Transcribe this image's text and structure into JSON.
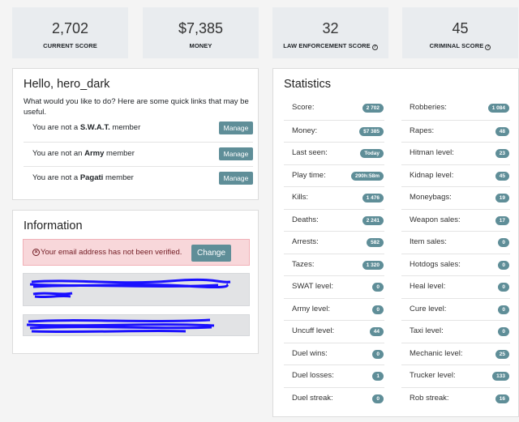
{
  "top_stats": [
    {
      "value": "2,702",
      "label": "CURRENT SCORE",
      "help": false
    },
    {
      "value": "$7,385",
      "label": "MONEY",
      "help": false
    },
    {
      "value": "32",
      "label": "LAW ENFORCEMENT SCORE",
      "help": true
    },
    {
      "value": "45",
      "label": "CRIMINAL SCORE",
      "help": true
    }
  ],
  "help_glyph": "?",
  "hello": {
    "title": "Hello, hero_dark",
    "intro": "What would you like to do? Here are some quick links that may be useful.",
    "rows": [
      {
        "pre": "You are not a ",
        "group": "S.W.A.T.",
        "post": " member",
        "button": "Manage"
      },
      {
        "pre": "You are not an ",
        "group": "Army",
        "post": " member",
        "button": "Manage"
      },
      {
        "pre": "You are not a ",
        "group": "Pagati",
        "post": " member",
        "button": "Manage"
      }
    ]
  },
  "information": {
    "title": "Information",
    "alert_icon": "x-circle-icon",
    "alert_glyph": "×",
    "alert_text": "Your email address has not been verified.",
    "change_button": "Change"
  },
  "statistics": {
    "title": "Statistics",
    "left": [
      {
        "label": "Score:",
        "value": "2 702"
      },
      {
        "label": "Money:",
        "value": "$7 385"
      },
      {
        "label": "Last seen:",
        "value": "Today"
      },
      {
        "label": "Play time:",
        "value": "290h:58m"
      },
      {
        "label": "Kills:",
        "value": "1 476"
      },
      {
        "label": "Deaths:",
        "value": "2 241"
      },
      {
        "label": "Arrests:",
        "value": "582"
      },
      {
        "label": "Tazes:",
        "value": "1 320"
      },
      {
        "label": "SWAT level:",
        "value": "0"
      },
      {
        "label": "Army level:",
        "value": "0"
      },
      {
        "label": "Uncuff level:",
        "value": "44"
      },
      {
        "label": "Duel wins:",
        "value": "0"
      },
      {
        "label": "Duel losses:",
        "value": "1"
      },
      {
        "label": "Duel streak:",
        "value": "0"
      }
    ],
    "right": [
      {
        "label": "Robberies:",
        "value": "1 084"
      },
      {
        "label": "Rapes:",
        "value": "48"
      },
      {
        "label": "Hitman level:",
        "value": "23"
      },
      {
        "label": "Kidnap level:",
        "value": "45"
      },
      {
        "label": "Moneybags:",
        "value": "19"
      },
      {
        "label": "Weapon sales:",
        "value": "17"
      },
      {
        "label": "Item sales:",
        "value": "0"
      },
      {
        "label": "Hotdogs sales:",
        "value": "0"
      },
      {
        "label": "Heal level:",
        "value": "0"
      },
      {
        "label": "Cure level:",
        "value": "0"
      },
      {
        "label": "Taxi level:",
        "value": "0"
      },
      {
        "label": "Mechanic level:",
        "value": "25"
      },
      {
        "label": "Trucker level:",
        "value": "133"
      },
      {
        "label": "Rob streak:",
        "value": "16"
      }
    ]
  },
  "colors": {
    "accent": "#5f8e98",
    "card_bg": "#e9ecef",
    "alert_bg": "#f8d7da",
    "redaction_ink": "#1a10ff"
  }
}
